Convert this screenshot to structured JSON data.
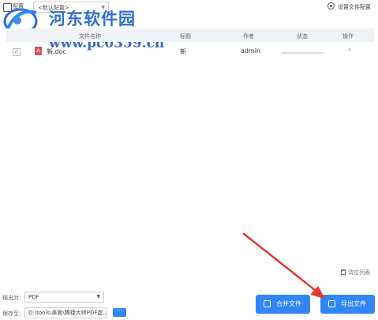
{
  "topbar": {
    "config_label": "配置",
    "config_select": "<默认配置>",
    "settings_label": "设置文件配置"
  },
  "watermark": {
    "title": "河东软件园",
    "url": "www.pc0359.cn"
  },
  "table": {
    "headers": [
      "文件名称",
      "标题",
      "作者",
      "状态",
      "操作"
    ],
    "rows": [
      {
        "checked": "✓",
        "file_icon": "A",
        "name": "新.doc",
        "title": "新",
        "author": "admin",
        "progress": 0,
        "op": "×"
      }
    ]
  },
  "footer": {
    "clear_label": "清空列表",
    "output_label": "输出为：",
    "output_value": "PDF",
    "path_label": "保存至：",
    "path_value": "D:\\tools\\桌面\\腾捷大师PDF虚...",
    "browse_label": "···",
    "merge_label": "合并文件",
    "export_label": "导出文件"
  },
  "colors": {
    "accent": "#2f86f6",
    "annotation_arrow": "#e53935",
    "watermark": "#2f6fd1"
  }
}
